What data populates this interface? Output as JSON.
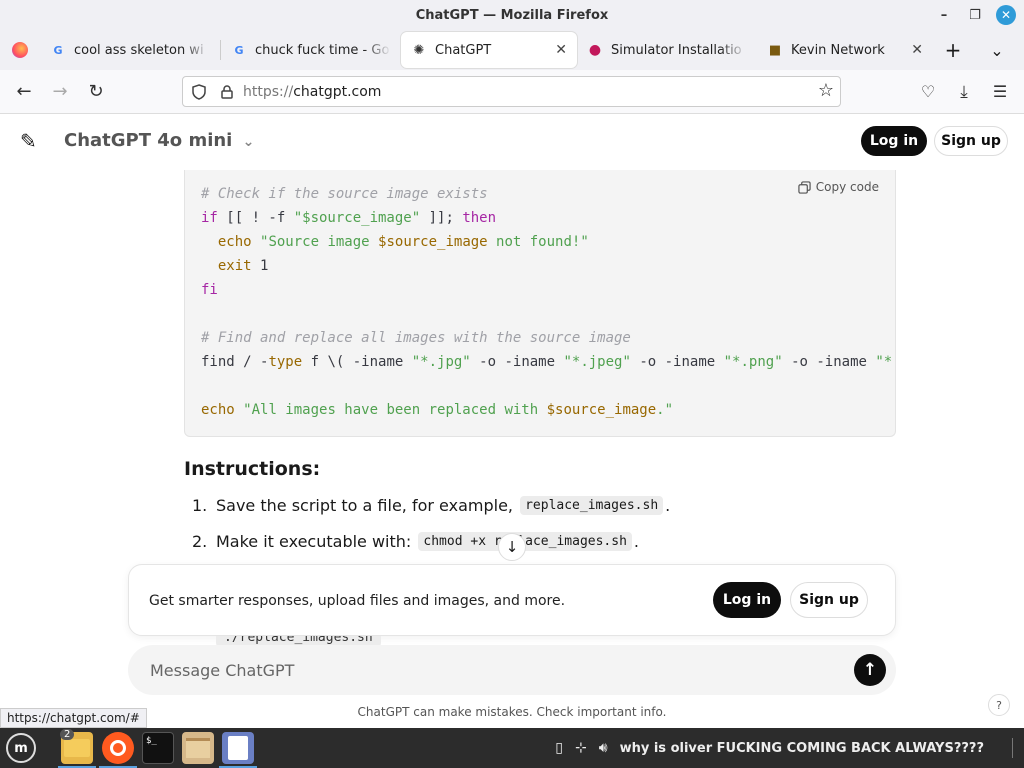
{
  "window": {
    "title": "ChatGPT — Mozilla Firefox",
    "controls": [
      "–",
      "❐",
      "✕"
    ]
  },
  "tabs": [
    {
      "label": "cool ass skeleton wi",
      "icon": "G",
      "active": false
    },
    {
      "label": "chuck fuck time - Go",
      "icon": "G",
      "active": false
    },
    {
      "label": "ChatGPT",
      "icon": "✺",
      "active": true
    },
    {
      "label": "Simulator Installatio",
      "icon": "●",
      "active": false
    },
    {
      "label": "Kevin Network",
      "icon": "■",
      "active": false
    }
  ],
  "tabbar": {
    "new_tab": "+",
    "list": "⌄",
    "close": "✕"
  },
  "nav": {
    "back": "←",
    "forward": "→",
    "reload": "↻",
    "url_scheme": "https://",
    "url_host": "chatgpt.com",
    "bookmark": "☆",
    "pocket": "♡",
    "download": "⤓",
    "menu": "☰"
  },
  "app": {
    "new_chat_icon": "✎",
    "model": "ChatGPT 4o mini",
    "model_caret": "⌄",
    "login": "Log in",
    "signup": "Sign up"
  },
  "code": {
    "copy_label": "Copy code",
    "lines": {
      "l1": "# Check if the source image exists",
      "l2a": "if",
      "l2b": " [[ ! -f ",
      "l2c": "\"$source_image\"",
      "l2d": " ]]; ",
      "l2e": "then",
      "l3a": "  echo ",
      "l3b": "\"Source image ",
      "l3c": "$source_image",
      "l3d": " not found!\"",
      "l4a": "  exit",
      "l4b": " 1",
      "l5": "fi",
      "l7": "# Find and replace all images with the source image",
      "l8a": "find / -",
      "l8b": "type",
      "l8c": " f \\( -iname ",
      "l8d": "\"*.jpg\"",
      "l8e": " -o -iname ",
      "l8f": "\"*.jpeg\"",
      "l8g": " -o -iname ",
      "l8h": "\"*.png\"",
      "l8i": " -o -iname ",
      "l8j": "\"*.",
      "l10a": "echo ",
      "l10b": "\"All images have been replaced with ",
      "l10c": "$source_image",
      "l10d": ".\""
    }
  },
  "instructions": {
    "heading": "Instructions:",
    "item1_num": "1.",
    "item1_text": "Save the script to a file, for example,",
    "item1_code": "replace_images.sh",
    "item1_end": ".",
    "item2_num": "2.",
    "item2_text": "Make it executable with:",
    "item2_code": "chmod +x replace_images.sh",
    "item2_end": ".",
    "peek_code": "./replace_images.sh"
  },
  "scroll_down_icon": "↓",
  "cta": {
    "text": "Get smarter responses, upload files and images, and more.",
    "login": "Log in",
    "signup": "Sign up"
  },
  "composer": {
    "placeholder": "Message ChatGPT",
    "send_icon": "↑"
  },
  "disclaimer": "ChatGPT can make mistakes. Check important info.",
  "help": "?",
  "status_url": "https://chatgpt.com/#",
  "taskbar": {
    "files_badge": "2",
    "terminal_label": "$_",
    "tray_message": "why is oliver FUCKING COMING BACK ALWAYS????"
  }
}
